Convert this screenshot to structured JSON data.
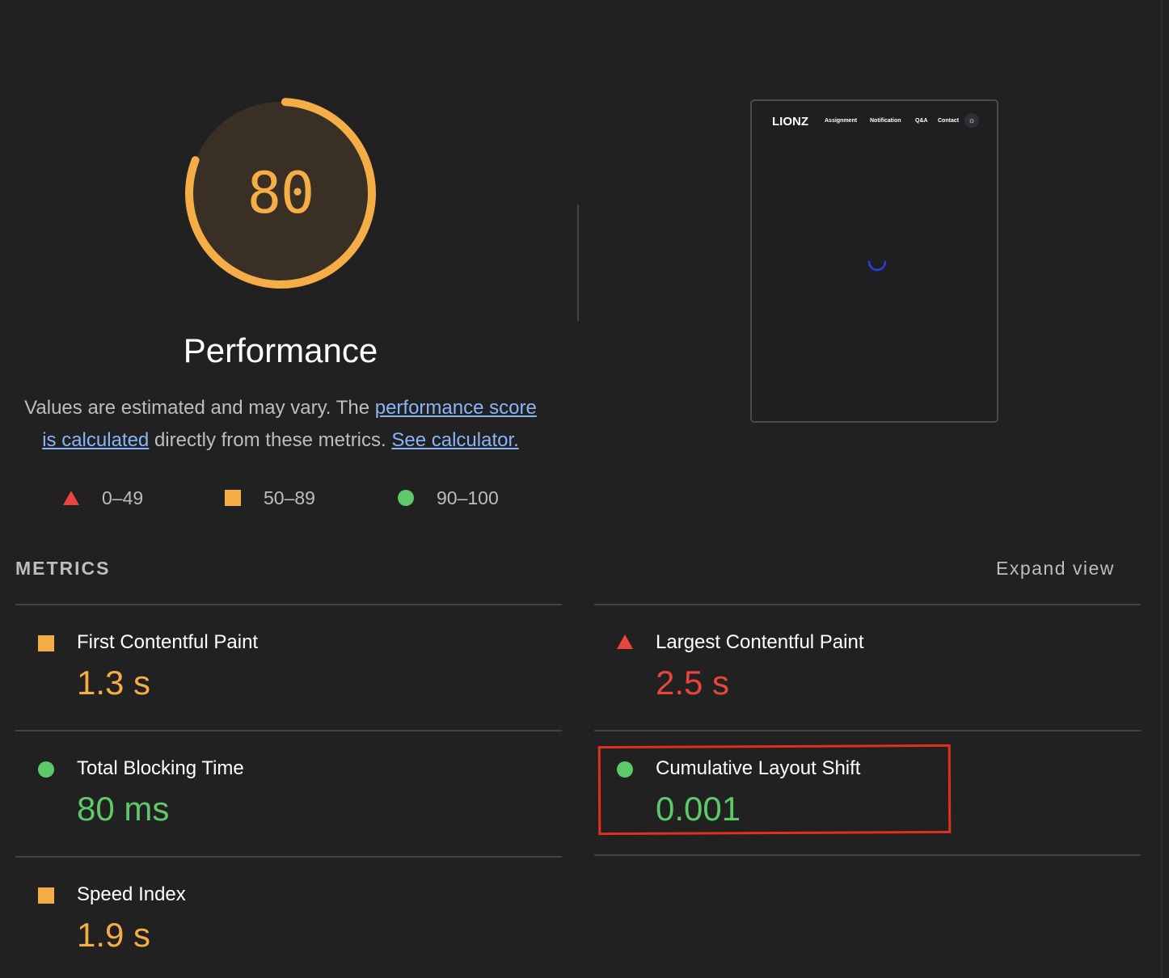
{
  "score": {
    "value": "80",
    "fraction": 0.8,
    "title": "Performance",
    "color": "#f5ad47"
  },
  "description": {
    "text_before": "Values are estimated and may vary. The ",
    "link1": "performance score is calculated",
    "text_middle": " directly from these metrics. ",
    "link2": "See calculator."
  },
  "legend": [
    {
      "shape": "triangle-icon",
      "range": "0–49",
      "color": "#e8453c"
    },
    {
      "shape": "square-icon",
      "range": "50–89",
      "color": "#f5ad47"
    },
    {
      "shape": "circle-icon",
      "range": "90–100",
      "color": "#5dc96b"
    }
  ],
  "thumbnail": {
    "logo": "LIONZ",
    "nav": [
      "Assignment",
      "Notification",
      "Q&A",
      "Contact"
    ],
    "theme_icon": "sun-icon",
    "spinner": "loading-spinner"
  },
  "metrics": {
    "header": "METRICS",
    "expand_label": "Expand view",
    "items": [
      {
        "label": "First Contentful Paint",
        "value": "1.3 s",
        "rating": "average",
        "icon": "square-icon"
      },
      {
        "label": "Largest Contentful Paint",
        "value": "2.5 s",
        "rating": "fail",
        "icon": "triangle-icon"
      },
      {
        "label": "Total Blocking Time",
        "value": "80 ms",
        "rating": "pass",
        "icon": "circle-icon"
      },
      {
        "label": "Cumulative Layout Shift",
        "value": "0.001",
        "rating": "pass",
        "icon": "circle-icon"
      },
      {
        "label": "Speed Index",
        "value": "1.9 s",
        "rating": "average",
        "icon": "square-icon"
      }
    ]
  },
  "colors": {
    "background": "#212121",
    "pass": "#5dc96b",
    "average": "#f5ad47",
    "fail": "#e8453c",
    "link": "#8ab4f8",
    "annotation": "#e0301e"
  }
}
